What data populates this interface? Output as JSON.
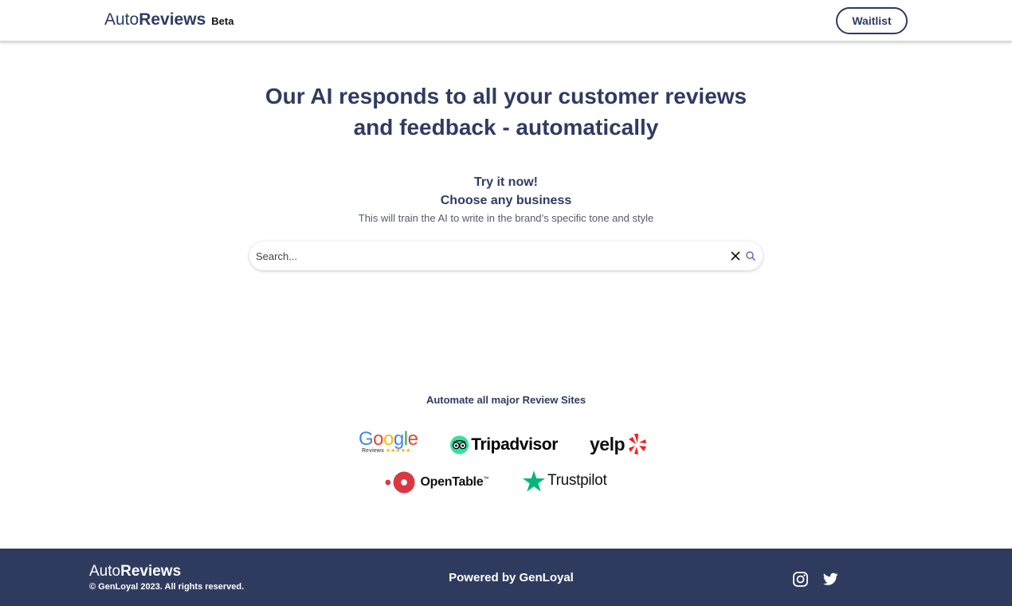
{
  "header": {
    "brand_prefix": "Auto",
    "brand_bold": "Reviews",
    "brand_tag": "Beta",
    "waitlist_label": "Waitlist"
  },
  "hero": {
    "title_line1": "Our AI responds to all your customer reviews",
    "title_line2": "and feedback - automatically",
    "try_now": "Try it now!",
    "choose": "Choose any business",
    "subtitle": "This will train the AI to write in the brand’s specific tone and style"
  },
  "search": {
    "placeholder": "Search...",
    "value": "",
    "clear_icon": "close-icon",
    "search_icon": "search-icon"
  },
  "sites": {
    "title": "Automate all major Review Sites",
    "google": {
      "word": "Google",
      "sub": "Reviews",
      "stars": "★★★★★"
    },
    "tripadvisor": "Tripadvisor",
    "yelp": "yelp",
    "opentable": "OpenTable",
    "opentable_tm": "™",
    "trustpilot": "Trustpilot"
  },
  "footer": {
    "brand_prefix": "Auto",
    "brand_bold": "Reviews",
    "copyright": "© GenLoyal 2023. All rights reserved.",
    "powered": "Powered by GenLoyal",
    "social": [
      "instagram-icon",
      "twitter-icon"
    ]
  },
  "colors": {
    "navy": "#2f3b62",
    "footer_bg": "#2f3b5e",
    "google_blue": "#4285f4",
    "google_red": "#ea4335",
    "google_yellow": "#fbbc05",
    "google_green": "#34a853",
    "tripadvisor_green": "#34e0a1",
    "yelp_red": "#ff1a1a",
    "opentable_red": "#da3743",
    "trustpilot_green": "#00b67a"
  }
}
